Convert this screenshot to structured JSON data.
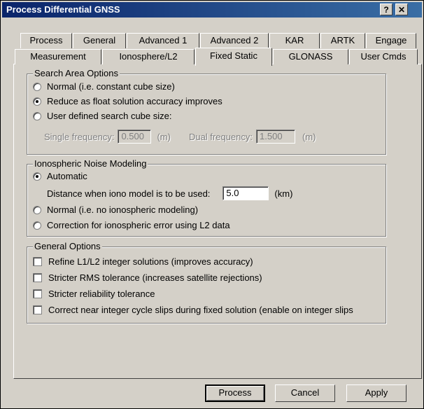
{
  "window": {
    "title": "Process Differential GNSS",
    "help_label": "?",
    "close_label": "✕"
  },
  "tabs_row1": [
    "Process",
    "General",
    "Advanced 1",
    "Advanced 2",
    "KAR",
    "ARTK",
    "Engage"
  ],
  "tabs_row2": [
    "Measurement",
    "Ionosphere/L2",
    "Fixed Static",
    "GLONASS",
    "User Cmds"
  ],
  "active_tab": "Fixed Static",
  "search_area": {
    "title": "Search Area Options",
    "options": [
      {
        "label": "Normal (i.e. constant cube size)",
        "selected": false
      },
      {
        "label": "Reduce as float solution accuracy improves",
        "selected": true
      },
      {
        "label": "User defined search cube size:",
        "selected": false
      }
    ],
    "single_label": "Single frequency:",
    "single_value": "0.500",
    "single_unit": "(m)",
    "dual_label": "Dual frequency:",
    "dual_value": "1.500",
    "dual_unit": "(m)"
  },
  "iono": {
    "title": "Ionospheric Noise Modeling",
    "automatic_label": "Automatic",
    "distance_label": "Distance when iono model is to be used:",
    "distance_value": "5.0",
    "distance_unit": "(km)",
    "normal_label": "Normal (i.e. no ionospheric modeling)",
    "correction_label": "Correction for ionospheric error using L2 data"
  },
  "general": {
    "title": "General Options",
    "options": [
      "Refine L1/L2 integer solutions (improves accuracy)",
      "Stricter RMS tolerance (increases satellite rejections)",
      "Stricter reliability tolerance",
      "Correct near integer cycle slips during fixed solution (enable on integer slips"
    ]
  },
  "buttons": {
    "process": "Process",
    "cancel": "Cancel",
    "apply": "Apply"
  }
}
